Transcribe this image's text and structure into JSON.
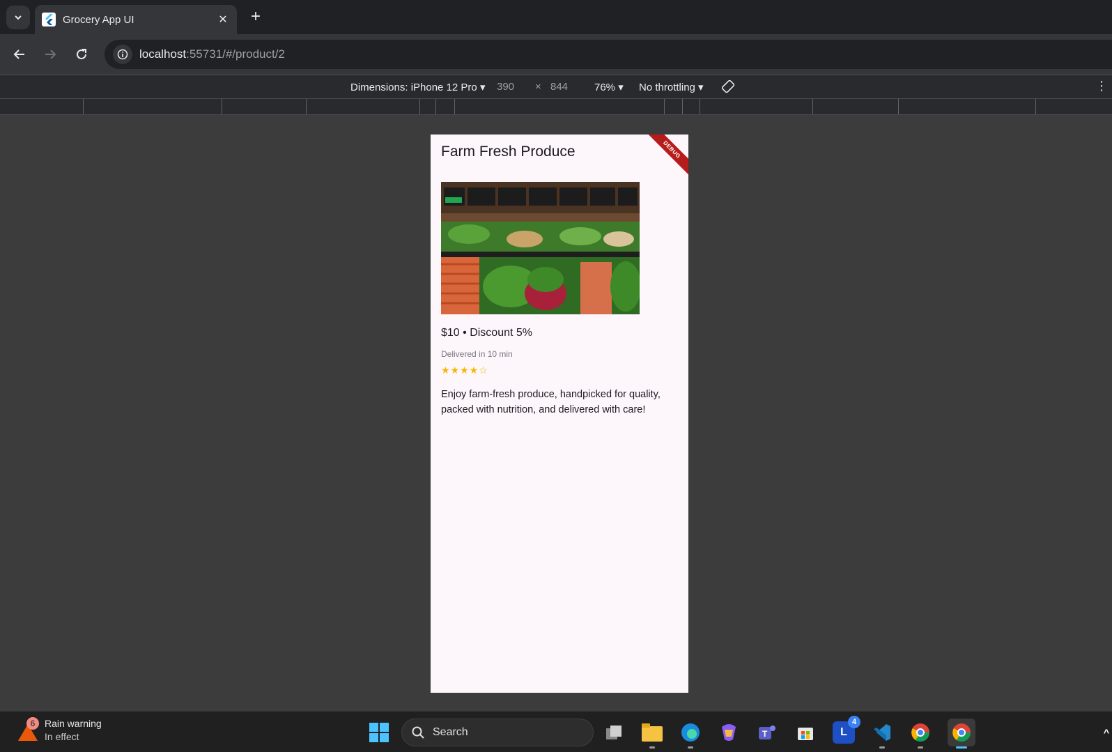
{
  "browser": {
    "tab_title": "Grocery App UI",
    "new_tab_label": "+",
    "close_label": "✕",
    "url_host": "localhost",
    "url_path": ":55731/#/product/2"
  },
  "devtools": {
    "dimensions_label": "Dimensions: iPhone 12 Pro",
    "width": "390",
    "times": "×",
    "height": "844",
    "zoom": "76%",
    "throttling": "No throttling"
  },
  "app": {
    "debug_banner": "DEBUG",
    "title": "Farm Fresh Produce",
    "price_line": "$10 • Discount 5%",
    "delivery": "Delivered in 10 min",
    "rating": 4,
    "rating_max": 5,
    "stars_text": "★★★★☆",
    "description": "Enjoy farm-fresh produce, handpicked for quality, packed with nutrition, and delivered with care!",
    "image_alt": "produce-image"
  },
  "taskbar": {
    "weather_badge": "6",
    "weather_title": "Rain warning",
    "weather_sub": "In effect",
    "search_label": "Search",
    "lens_badge": "4"
  }
}
